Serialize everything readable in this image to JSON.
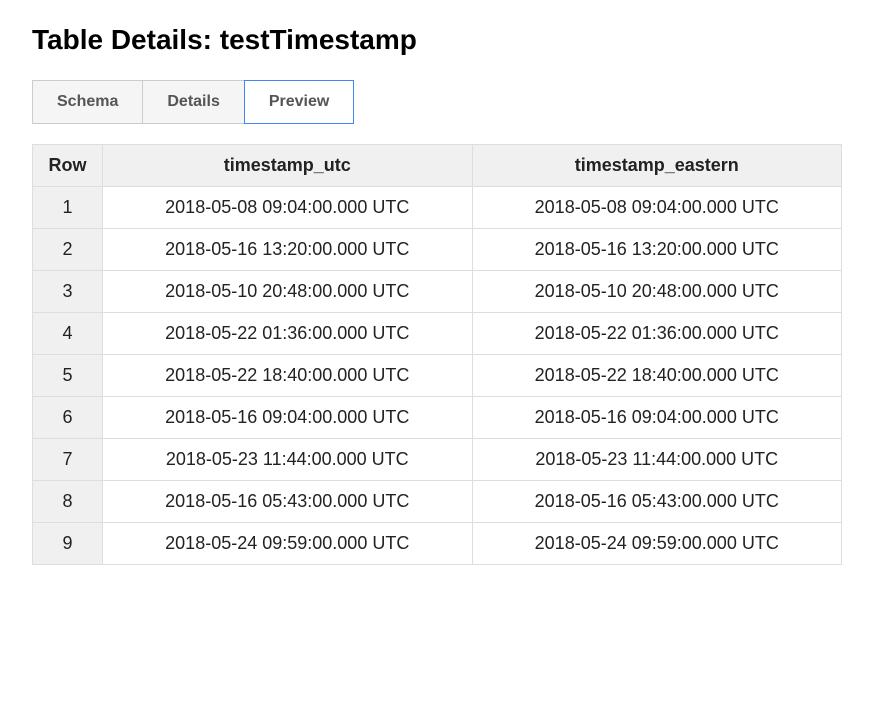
{
  "header": {
    "title": "Table Details: testTimestamp"
  },
  "tabs": {
    "schema": "Schema",
    "details": "Details",
    "preview": "Preview"
  },
  "table": {
    "headers": {
      "row": "Row",
      "col1": "timestamp_utc",
      "col2": "timestamp_eastern"
    },
    "rows": [
      {
        "n": "1",
        "utc": "2018-05-08 09:04:00.000 UTC",
        "eastern": "2018-05-08 09:04:00.000 UTC"
      },
      {
        "n": "2",
        "utc": "2018-05-16 13:20:00.000 UTC",
        "eastern": "2018-05-16 13:20:00.000 UTC"
      },
      {
        "n": "3",
        "utc": "2018-05-10 20:48:00.000 UTC",
        "eastern": "2018-05-10 20:48:00.000 UTC"
      },
      {
        "n": "4",
        "utc": "2018-05-22 01:36:00.000 UTC",
        "eastern": "2018-05-22 01:36:00.000 UTC"
      },
      {
        "n": "5",
        "utc": "2018-05-22 18:40:00.000 UTC",
        "eastern": "2018-05-22 18:40:00.000 UTC"
      },
      {
        "n": "6",
        "utc": "2018-05-16 09:04:00.000 UTC",
        "eastern": "2018-05-16 09:04:00.000 UTC"
      },
      {
        "n": "7",
        "utc": "2018-05-23 11:44:00.000 UTC",
        "eastern": "2018-05-23 11:44:00.000 UTC"
      },
      {
        "n": "8",
        "utc": "2018-05-16 05:43:00.000 UTC",
        "eastern": "2018-05-16 05:43:00.000 UTC"
      },
      {
        "n": "9",
        "utc": "2018-05-24 09:59:00.000 UTC",
        "eastern": "2018-05-24 09:59:00.000 UTC"
      }
    ]
  }
}
